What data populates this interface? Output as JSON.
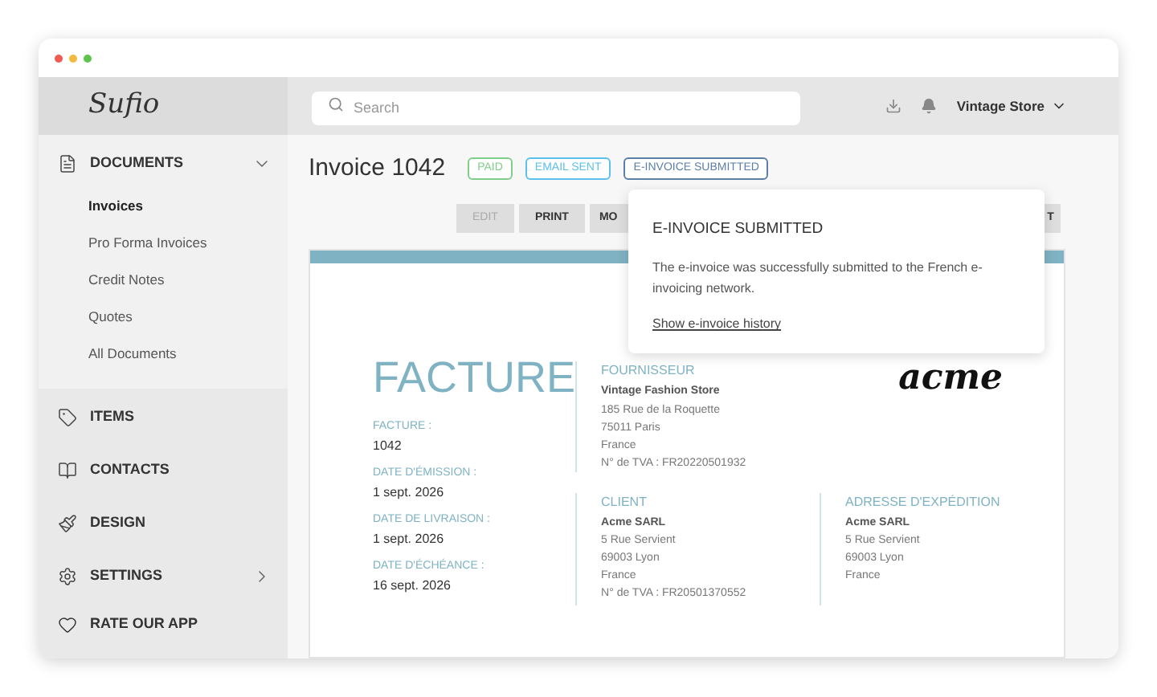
{
  "sidebar": {
    "sections": [
      {
        "label": "DOCUMENTS",
        "expanded": true,
        "children": [
          {
            "label": "Invoices",
            "selected": true
          },
          {
            "label": "Pro Forma Invoices",
            "selected": false
          },
          {
            "label": "Credit Notes",
            "selected": false
          },
          {
            "label": "Quotes",
            "selected": false
          },
          {
            "label": "All Documents",
            "selected": false
          }
        ]
      },
      {
        "label": "ITEMS",
        "expanded": false
      },
      {
        "label": "CONTACTS",
        "expanded": false
      },
      {
        "label": "DESIGN",
        "expanded": false
      },
      {
        "label": "SETTINGS",
        "expanded": false,
        "has_submenu": true
      }
    ],
    "footer": {
      "label": "RATE OUR APP"
    },
    "logo": "Sufio"
  },
  "topbar": {
    "search": {
      "placeholder": "Search"
    },
    "account": "Vintage Store"
  },
  "invoice": {
    "title": "Invoice 1042",
    "badges": [
      {
        "label": "PAID",
        "color": "#7fcf8a"
      },
      {
        "label": "EMAIL SENT",
        "color": "#5bc0eb"
      },
      {
        "label": "E-INVOICE SUBMITTED",
        "color": "#5b7fa6"
      }
    ],
    "toolbar": [
      {
        "label": "EDIT",
        "disabled": true
      },
      {
        "label": "PRINT",
        "disabled": false
      },
      {
        "label": "MO",
        "disabled": false
      },
      {
        "label": "T",
        "disabled": false
      }
    ],
    "popover": {
      "title": "E-INVOICE SUBMITTED",
      "body": "The e-invoice was successfully submitted to the French e-invoicing network.",
      "link": "Show e-invoice history"
    },
    "document": {
      "heading": "FACTURE",
      "logo": "acme",
      "fields": [
        {
          "label": "FACTURE :",
          "value": "1042"
        },
        {
          "label": "DATE D'ÉMISSION :",
          "value": "1 sept. 2026"
        },
        {
          "label": "DATE DE LIVRAISON :",
          "value": "1 sept. 2026"
        },
        {
          "label": "DATE D'ÉCHÉANCE :",
          "value": "16 sept. 2026"
        }
      ],
      "supplier": {
        "label": "FOURNISSEUR",
        "name": "Vintage Fashion Store",
        "lines": [
          "185 Rue de la Roquette",
          "75011 Paris",
          "France",
          "N° de TVA : FR20220501932"
        ]
      },
      "addresses": [
        {
          "label": "CLIENT",
          "name": "Acme SARL",
          "lines": [
            "5 Rue Servient",
            "69003 Lyon",
            "France",
            "N° de TVA : FR20501370552"
          ]
        },
        {
          "label": "ADRESSE D'EXPÉDITION",
          "name": "Acme SARL",
          "lines": [
            "5 Rue Servient",
            "69003 Lyon",
            "France"
          ]
        }
      ]
    }
  }
}
